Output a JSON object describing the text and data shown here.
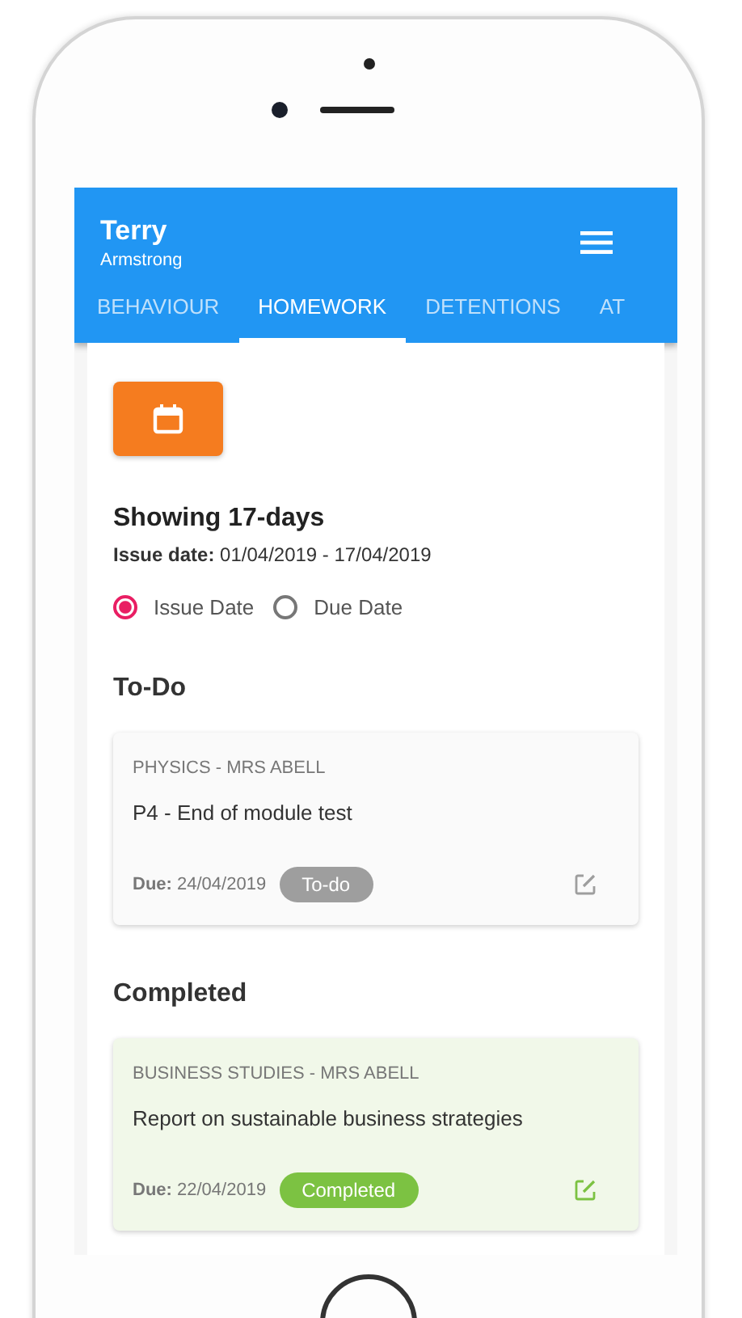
{
  "header": {
    "title": "Terry",
    "subtitle": "Armstrong"
  },
  "tabs": [
    {
      "label": "BEHAVIOUR",
      "selected": false
    },
    {
      "label": "HOMEWORK",
      "selected": true
    },
    {
      "label": "DETENTIONS",
      "selected": false
    },
    {
      "label": "AT",
      "selected": false
    }
  ],
  "summary": {
    "heading": "Showing 17-days",
    "range": "**Issue date:** 01/04/2019 - 17/04/2019"
  },
  "radios": [
    {
      "label": "Issue Date",
      "selected": true
    },
    {
      "label": "Due Date",
      "selected": false
    }
  ],
  "sections": [
    {
      "title": "To-Do",
      "cards": [
        {
          "subject": "PHYSICS - MRS ABELL",
          "title": "P4 - End of module test",
          "due": "**Due:** 24/04/2019",
          "status": "To-do",
          "kind": "todo"
        }
      ]
    },
    {
      "title": "Completed",
      "cards": [
        {
          "subject": "BUSINESS STUDIES - MRS ABELL",
          "title": "Report on sustainable business strategies",
          "due": "**Due:** 22/04/2019",
          "status": "Completed",
          "kind": "completed"
        }
      ]
    }
  ]
}
